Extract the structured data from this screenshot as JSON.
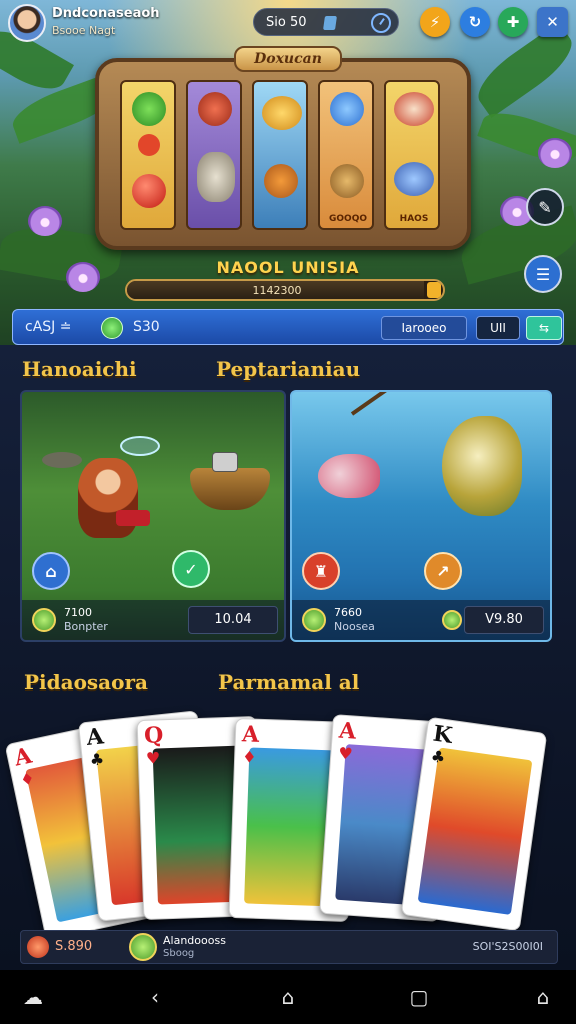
{
  "header": {
    "profile_name": "Dndconaseaoh",
    "profile_sub": "Bsooe Nagt",
    "balance": "Sio 50",
    "buttons": {
      "lightning": "⚡",
      "refresh": "↻",
      "puzzle": "✚",
      "close": "✕"
    }
  },
  "slot": {
    "banner": "Doxucan",
    "reel_labels": [
      "",
      "",
      "",
      "GOOQO",
      "HAOS"
    ],
    "title": "NAOOL UNISIA",
    "progress_label": "1142300",
    "progress_fraction": 0.94
  },
  "status": {
    "left": "cASJ ≐",
    "amount": "S30",
    "btn1": "Iarooeo",
    "btn2": "UII",
    "btn3": "⇆"
  },
  "sections": {
    "first_left": "Hanoaichi",
    "first_right": "Peptarianiau",
    "second_left": "Pidaosaora",
    "second_right": "Parmamal al"
  },
  "cards": {
    "jungle": {
      "value": "7100",
      "label": "Bonpter",
      "price": "10.04"
    },
    "water": {
      "value": "7660",
      "label": "Noosea",
      "price": "V9.80"
    }
  },
  "bottom": {
    "left": "S.890",
    "center_name": "Alandoooss",
    "center_sub": "Sboog",
    "right": "SOI'S2S00I0I"
  },
  "playing_cards": [
    {
      "rank": "A",
      "suit": "♦",
      "color": "#d81f2a"
    },
    {
      "rank": "A",
      "suit": "♣",
      "color": "#111111"
    },
    {
      "rank": "Q",
      "suit": "♥",
      "color": "#d81f2a"
    },
    {
      "rank": "A",
      "suit": "♦",
      "color": "#d81f2a"
    },
    {
      "rank": "A",
      "suit": "♥",
      "color": "#d81f2a"
    },
    {
      "rank": "K",
      "suit": "♣",
      "color": "#111111"
    }
  ],
  "nav": {
    "home": "⌂",
    "back": "‹",
    "recent": "▢"
  }
}
